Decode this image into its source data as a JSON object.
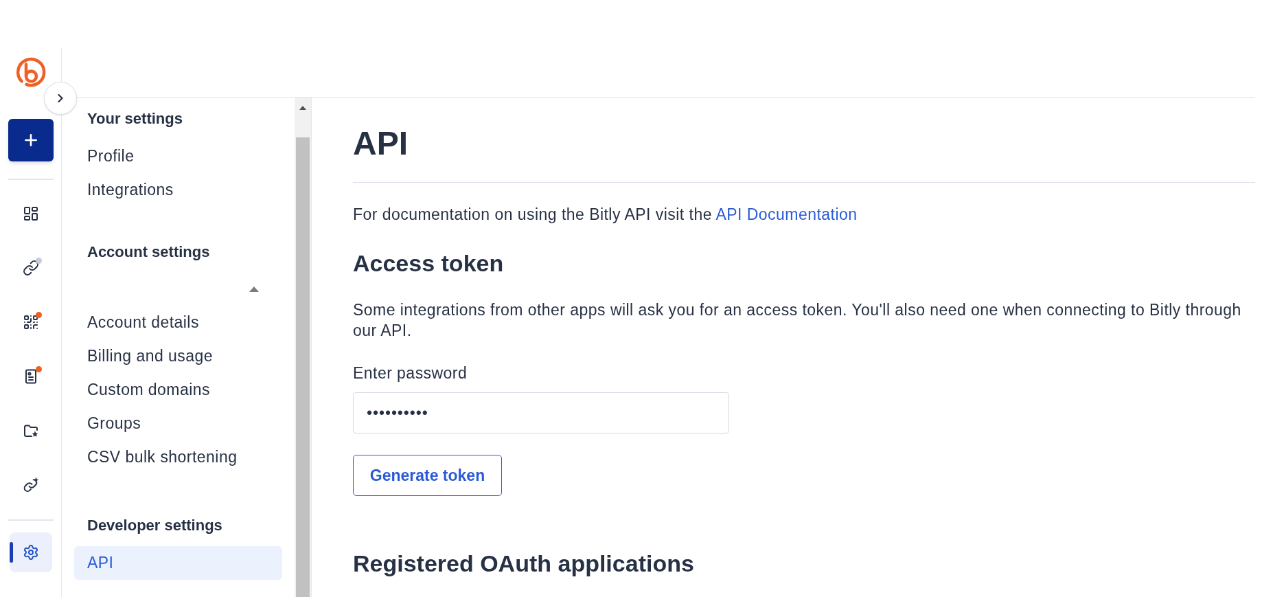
{
  "rail": {
    "nav_items": [
      {
        "kind": "home",
        "selected": false
      },
      {
        "kind": "links",
        "selected": false,
        "color": "#c5cbd9"
      },
      {
        "kind": "qr",
        "selected": false,
        "color": "#ee6123"
      },
      {
        "kind": "pages",
        "selected": false,
        "color": "#ee6123"
      },
      {
        "kind": "campaigns",
        "selected": false
      },
      {
        "kind": "custom_links",
        "selected": false
      }
    ],
    "bottom_items": [
      {
        "kind": "settings",
        "selected": true
      }
    ]
  },
  "sidebar": {
    "sections": [
      {
        "title": "Your settings",
        "items": [
          {
            "label": "Profile",
            "selected": false
          },
          {
            "label": "Integrations",
            "selected": false
          }
        ]
      },
      {
        "title": "Account settings",
        "account_picker": {
          "expanded": true
        },
        "items": [
          {
            "label": "Account details",
            "selected": false
          },
          {
            "label": "Billing and usage",
            "selected": false
          },
          {
            "label": "Custom domains",
            "selected": false
          },
          {
            "label": "Groups",
            "selected": false
          },
          {
            "label": "CSV bulk shortening",
            "selected": false
          }
        ]
      },
      {
        "title": "Developer settings",
        "items": [
          {
            "label": "API",
            "selected": true
          }
        ]
      }
    ]
  },
  "main": {
    "title": "API",
    "intro": {
      "text": "For documentation on using the Bitly API visit the ",
      "link": "API Documentation"
    },
    "access_token": {
      "heading": "Access token",
      "description": "Some integrations from other apps will ask you for an access token. You'll also need one when connecting to Bitly through our API.",
      "password_label": "Enter password",
      "password_value": "••••••••••",
      "button": "Generate token"
    },
    "oauth": {
      "heading": "Registered OAuth applications"
    }
  }
}
